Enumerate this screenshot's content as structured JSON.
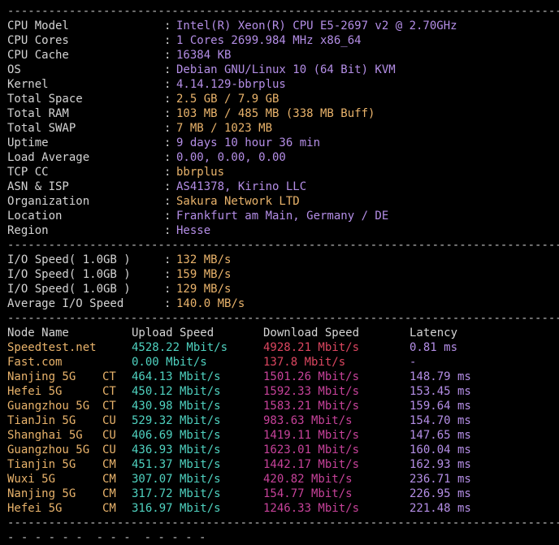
{
  "top_partial": "- - - -  - - -  - - - -  -  - - - - - - - - - -",
  "separator": "--------------------------------------------------------------------------------------",
  "system_info": [
    {
      "key": "CPU Model",
      "value": "Intel(R) Xeon(R) CPU E5-2697 v2 @ 2.70GHz",
      "color": "purple"
    },
    {
      "key": "CPU Cores",
      "value": "1 Cores 2699.984 MHz x86_64",
      "color": "purple"
    },
    {
      "key": "CPU Cache",
      "value": "16384 KB",
      "color": "purple"
    },
    {
      "key": "OS",
      "value": "Debian GNU/Linux 10 (64 Bit) KVM",
      "color": "purple"
    },
    {
      "key": "Kernel",
      "value": "4.14.129-bbrplus",
      "color": "purple"
    },
    {
      "key": "Total Space",
      "value": "2.5 GB / 7.9 GB",
      "color": "orange"
    },
    {
      "key": "Total RAM",
      "value": "103 MB / 485 MB (338 MB Buff)",
      "color": "orange"
    },
    {
      "key": "Total SWAP",
      "value": "7 MB / 1023 MB",
      "color": "orange"
    },
    {
      "key": "Uptime",
      "value": "9 days 10 hour 36 min",
      "color": "purple"
    },
    {
      "key": "Load Average",
      "value": "0.00, 0.00, 0.00",
      "color": "purple"
    },
    {
      "key": "TCP CC",
      "value": "bbrplus",
      "color": "orange"
    },
    {
      "key": "ASN & ISP",
      "value": "AS41378, Kirino LLC",
      "color": "purple"
    },
    {
      "key": "Organization",
      "value": "Sakura Network LTD",
      "color": "orange"
    },
    {
      "key": "Location",
      "value": "Frankfurt am Main, Germany / DE",
      "color": "purple"
    },
    {
      "key": "Region",
      "value": "Hesse",
      "color": "purple"
    }
  ],
  "io_info": [
    {
      "key": "I/O Speed( 1.0GB )",
      "value": "132 MB/s"
    },
    {
      "key": "I/O Speed( 1.0GB )",
      "value": "159 MB/s"
    },
    {
      "key": "I/O Speed( 1.0GB )",
      "value": "129 MB/s"
    },
    {
      "key": "Average I/O Speed",
      "value": "140.0 MB/s"
    }
  ],
  "speed_table": {
    "headers": {
      "node": "Node Name",
      "upload": "Upload Speed",
      "download": "Download Speed",
      "latency": "Latency"
    },
    "rows": [
      {
        "node": "Speedtest.net",
        "tag": "",
        "upload": "4528.22 Mbit/s",
        "download": "4928.21 Mbit/s",
        "latency": "0.81 ms"
      },
      {
        "node": "Fast.com",
        "tag": "",
        "upload": "0.00 Mbit/s",
        "download": "137.8 Mbit/s",
        "latency": "-"
      },
      {
        "node": "Nanjing 5G",
        "tag": "CT",
        "upload": "464.13 Mbit/s",
        "download": "1501.26 Mbit/s",
        "latency": "148.79 ms"
      },
      {
        "node": "Hefei 5G",
        "tag": "CT",
        "upload": "450.12 Mbit/s",
        "download": "1592.33 Mbit/s",
        "latency": "153.45 ms"
      },
      {
        "node": "Guangzhou 5G",
        "tag": "CT",
        "upload": "430.98 Mbit/s",
        "download": "1583.21 Mbit/s",
        "latency": "159.64 ms"
      },
      {
        "node": "TianJin 5G",
        "tag": "CU",
        "upload": "529.32 Mbit/s",
        "download": "983.63 Mbit/s",
        "latency": "154.70 ms"
      },
      {
        "node": "Shanghai 5G",
        "tag": "CU",
        "upload": "406.69 Mbit/s",
        "download": "1419.11 Mbit/s",
        "latency": "147.65 ms"
      },
      {
        "node": "Guangzhou 5G",
        "tag": "CU",
        "upload": "436.93 Mbit/s",
        "download": "1623.01 Mbit/s",
        "latency": "160.04 ms"
      },
      {
        "node": "Tianjin 5G",
        "tag": "CM",
        "upload": "451.37 Mbit/s",
        "download": "1442.17 Mbit/s",
        "latency": "162.93 ms"
      },
      {
        "node": "Wuxi 5G",
        "tag": "CM",
        "upload": "307.07 Mbit/s",
        "download": "420.82 Mbit/s",
        "latency": "236.71 ms"
      },
      {
        "node": "Nanjing 5G",
        "tag": "CM",
        "upload": "317.72 Mbit/s",
        "download": "154.77 Mbit/s",
        "latency": "226.95 ms"
      },
      {
        "node": "Hefei 5G",
        "tag": "CM",
        "upload": "316.97 Mbit/s",
        "download": "1246.33 Mbit/s",
        "latency": "221.48 ms"
      }
    ]
  },
  "bottom_partial": "- - - - - -  - - -  - - - - -",
  "colors": {
    "background": "#000000",
    "label": "#d4d4d4",
    "purple": "#b48ee6",
    "orange": "#e9b36b",
    "teal": "#4fd2c0",
    "red": "#dc4660",
    "pink": "#c7429a"
  }
}
